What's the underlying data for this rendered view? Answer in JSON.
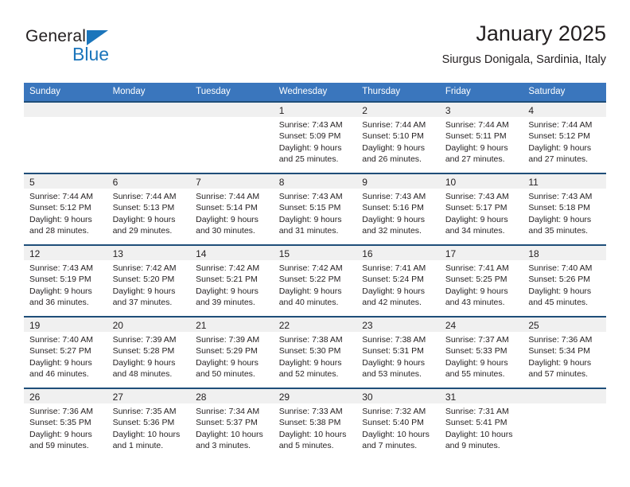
{
  "brand": {
    "name_part1": "General",
    "name_part2": "Blue",
    "triangle_color": "#1b75bb"
  },
  "header": {
    "title": "January 2025",
    "subtitle": "Siurgus Donigala, Sardinia, Italy"
  },
  "theme": {
    "header_bg": "#3a76bd",
    "week_separator": "#1f4e79",
    "daynum_band": "#f0f0f0",
    "text": "#231f20"
  },
  "weekdays": [
    "Sunday",
    "Monday",
    "Tuesday",
    "Wednesday",
    "Thursday",
    "Friday",
    "Saturday"
  ],
  "weeks": [
    [
      {
        "empty": true
      },
      {
        "empty": true
      },
      {
        "empty": true
      },
      {
        "day": "1",
        "sunrise": "Sunrise: 7:43 AM",
        "sunset": "Sunset: 5:09 PM",
        "daylight1": "Daylight: 9 hours",
        "daylight2": "and 25 minutes."
      },
      {
        "day": "2",
        "sunrise": "Sunrise: 7:44 AM",
        "sunset": "Sunset: 5:10 PM",
        "daylight1": "Daylight: 9 hours",
        "daylight2": "and 26 minutes."
      },
      {
        "day": "3",
        "sunrise": "Sunrise: 7:44 AM",
        "sunset": "Sunset: 5:11 PM",
        "daylight1": "Daylight: 9 hours",
        "daylight2": "and 27 minutes."
      },
      {
        "day": "4",
        "sunrise": "Sunrise: 7:44 AM",
        "sunset": "Sunset: 5:12 PM",
        "daylight1": "Daylight: 9 hours",
        "daylight2": "and 27 minutes."
      }
    ],
    [
      {
        "day": "5",
        "sunrise": "Sunrise: 7:44 AM",
        "sunset": "Sunset: 5:12 PM",
        "daylight1": "Daylight: 9 hours",
        "daylight2": "and 28 minutes."
      },
      {
        "day": "6",
        "sunrise": "Sunrise: 7:44 AM",
        "sunset": "Sunset: 5:13 PM",
        "daylight1": "Daylight: 9 hours",
        "daylight2": "and 29 minutes."
      },
      {
        "day": "7",
        "sunrise": "Sunrise: 7:44 AM",
        "sunset": "Sunset: 5:14 PM",
        "daylight1": "Daylight: 9 hours",
        "daylight2": "and 30 minutes."
      },
      {
        "day": "8",
        "sunrise": "Sunrise: 7:43 AM",
        "sunset": "Sunset: 5:15 PM",
        "daylight1": "Daylight: 9 hours",
        "daylight2": "and 31 minutes."
      },
      {
        "day": "9",
        "sunrise": "Sunrise: 7:43 AM",
        "sunset": "Sunset: 5:16 PM",
        "daylight1": "Daylight: 9 hours",
        "daylight2": "and 32 minutes."
      },
      {
        "day": "10",
        "sunrise": "Sunrise: 7:43 AM",
        "sunset": "Sunset: 5:17 PM",
        "daylight1": "Daylight: 9 hours",
        "daylight2": "and 34 minutes."
      },
      {
        "day": "11",
        "sunrise": "Sunrise: 7:43 AM",
        "sunset": "Sunset: 5:18 PM",
        "daylight1": "Daylight: 9 hours",
        "daylight2": "and 35 minutes."
      }
    ],
    [
      {
        "day": "12",
        "sunrise": "Sunrise: 7:43 AM",
        "sunset": "Sunset: 5:19 PM",
        "daylight1": "Daylight: 9 hours",
        "daylight2": "and 36 minutes."
      },
      {
        "day": "13",
        "sunrise": "Sunrise: 7:42 AM",
        "sunset": "Sunset: 5:20 PM",
        "daylight1": "Daylight: 9 hours",
        "daylight2": "and 37 minutes."
      },
      {
        "day": "14",
        "sunrise": "Sunrise: 7:42 AM",
        "sunset": "Sunset: 5:21 PM",
        "daylight1": "Daylight: 9 hours",
        "daylight2": "and 39 minutes."
      },
      {
        "day": "15",
        "sunrise": "Sunrise: 7:42 AM",
        "sunset": "Sunset: 5:22 PM",
        "daylight1": "Daylight: 9 hours",
        "daylight2": "and 40 minutes."
      },
      {
        "day": "16",
        "sunrise": "Sunrise: 7:41 AM",
        "sunset": "Sunset: 5:24 PM",
        "daylight1": "Daylight: 9 hours",
        "daylight2": "and 42 minutes."
      },
      {
        "day": "17",
        "sunrise": "Sunrise: 7:41 AM",
        "sunset": "Sunset: 5:25 PM",
        "daylight1": "Daylight: 9 hours",
        "daylight2": "and 43 minutes."
      },
      {
        "day": "18",
        "sunrise": "Sunrise: 7:40 AM",
        "sunset": "Sunset: 5:26 PM",
        "daylight1": "Daylight: 9 hours",
        "daylight2": "and 45 minutes."
      }
    ],
    [
      {
        "day": "19",
        "sunrise": "Sunrise: 7:40 AM",
        "sunset": "Sunset: 5:27 PM",
        "daylight1": "Daylight: 9 hours",
        "daylight2": "and 46 minutes."
      },
      {
        "day": "20",
        "sunrise": "Sunrise: 7:39 AM",
        "sunset": "Sunset: 5:28 PM",
        "daylight1": "Daylight: 9 hours",
        "daylight2": "and 48 minutes."
      },
      {
        "day": "21",
        "sunrise": "Sunrise: 7:39 AM",
        "sunset": "Sunset: 5:29 PM",
        "daylight1": "Daylight: 9 hours",
        "daylight2": "and 50 minutes."
      },
      {
        "day": "22",
        "sunrise": "Sunrise: 7:38 AM",
        "sunset": "Sunset: 5:30 PM",
        "daylight1": "Daylight: 9 hours",
        "daylight2": "and 52 minutes."
      },
      {
        "day": "23",
        "sunrise": "Sunrise: 7:38 AM",
        "sunset": "Sunset: 5:31 PM",
        "daylight1": "Daylight: 9 hours",
        "daylight2": "and 53 minutes."
      },
      {
        "day": "24",
        "sunrise": "Sunrise: 7:37 AM",
        "sunset": "Sunset: 5:33 PM",
        "daylight1": "Daylight: 9 hours",
        "daylight2": "and 55 minutes."
      },
      {
        "day": "25",
        "sunrise": "Sunrise: 7:36 AM",
        "sunset": "Sunset: 5:34 PM",
        "daylight1": "Daylight: 9 hours",
        "daylight2": "and 57 minutes."
      }
    ],
    [
      {
        "day": "26",
        "sunrise": "Sunrise: 7:36 AM",
        "sunset": "Sunset: 5:35 PM",
        "daylight1": "Daylight: 9 hours",
        "daylight2": "and 59 minutes."
      },
      {
        "day": "27",
        "sunrise": "Sunrise: 7:35 AM",
        "sunset": "Sunset: 5:36 PM",
        "daylight1": "Daylight: 10 hours",
        "daylight2": "and 1 minute."
      },
      {
        "day": "28",
        "sunrise": "Sunrise: 7:34 AM",
        "sunset": "Sunset: 5:37 PM",
        "daylight1": "Daylight: 10 hours",
        "daylight2": "and 3 minutes."
      },
      {
        "day": "29",
        "sunrise": "Sunrise: 7:33 AM",
        "sunset": "Sunset: 5:38 PM",
        "daylight1": "Daylight: 10 hours",
        "daylight2": "and 5 minutes."
      },
      {
        "day": "30",
        "sunrise": "Sunrise: 7:32 AM",
        "sunset": "Sunset: 5:40 PM",
        "daylight1": "Daylight: 10 hours",
        "daylight2": "and 7 minutes."
      },
      {
        "day": "31",
        "sunrise": "Sunrise: 7:31 AM",
        "sunset": "Sunset: 5:41 PM",
        "daylight1": "Daylight: 10 hours",
        "daylight2": "and 9 minutes."
      },
      {
        "empty": true
      }
    ]
  ]
}
